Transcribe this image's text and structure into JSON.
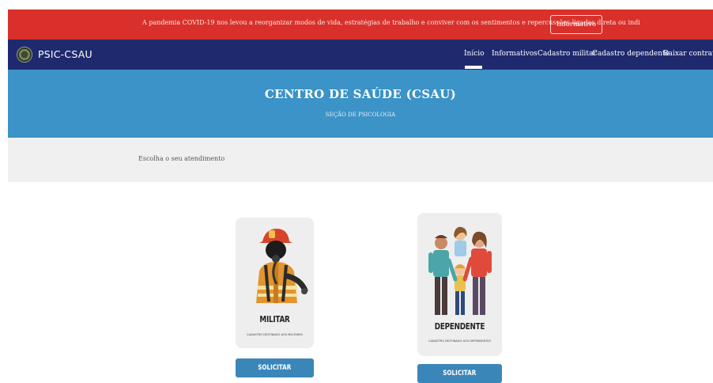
{
  "alert": {
    "text": "A pandemia COVID-19 nos levou a reorganizar modos de vida, estratégias de trabalho e conviver com os sentimentos e repercussões ligadas direta ou indi",
    "button_label": "Informativo"
  },
  "nav": {
    "brand": "PSIC-CSAU",
    "items": [
      {
        "label": "Início"
      },
      {
        "label": "Informativos"
      },
      {
        "label": "Cadastro militar"
      },
      {
        "label": "Cadastro dependente"
      },
      {
        "label": "Baixar contrato"
      }
    ]
  },
  "hero": {
    "title": "CENTRO DE SAÚDE (CSAU)",
    "subtitle": "SEÇÃO DE PSICOLOGIA"
  },
  "subheader": {
    "text": "Escolha o seu atendimento"
  },
  "cards": [
    {
      "title": "MILITAR",
      "description": "CADASTRO DESTINADO AOS MILITARES",
      "button_label": "SOLICITAR",
      "icon": "firefighter-icon"
    },
    {
      "title": "DEPENDENTE",
      "description": "CADASTRO DESTINADO AOS DEPENDENTES",
      "button_label": "SOLICITAR",
      "icon": "family-icon"
    }
  ],
  "colors": {
    "alert_bg": "#d9302b",
    "nav_bg": "#1f2a6e",
    "hero_bg": "#3b93c7",
    "button_bg": "#3b86b9"
  }
}
